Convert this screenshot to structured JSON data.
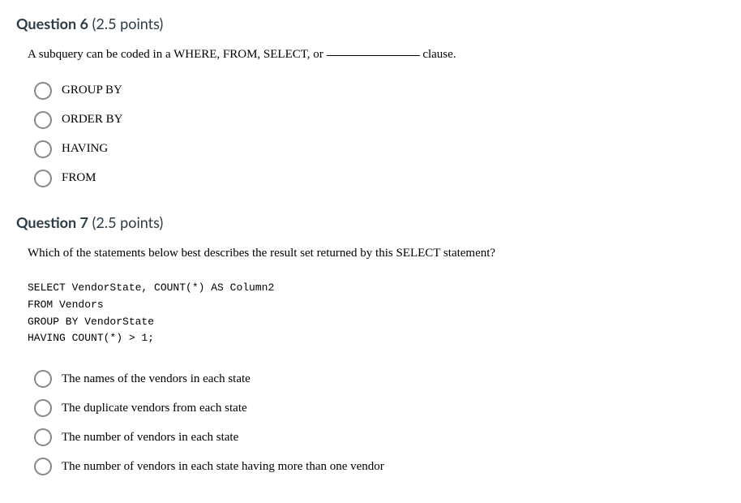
{
  "q6": {
    "title": "Question 6",
    "points": "(2.5 points)",
    "prompt_before": "A subquery can be coded in a WHERE, FROM, SELECT, or ",
    "prompt_after": " clause.",
    "options": [
      "GROUP BY",
      "ORDER BY",
      "HAVING",
      "FROM"
    ]
  },
  "q7": {
    "title": "Question 7",
    "points": "(2.5 points)",
    "prompt": "Which of the statements below best describes the result set returned by this SELECT statement?",
    "code": "SELECT VendorState, COUNT(*) AS Column2\nFROM Vendors\nGROUP BY VendorState\nHAVING COUNT(*) > 1;",
    "options": [
      "The names of the vendors in each state",
      "The duplicate vendors from each state",
      "The number of vendors in each state",
      "The number of vendors in each state having more than one vendor"
    ]
  }
}
